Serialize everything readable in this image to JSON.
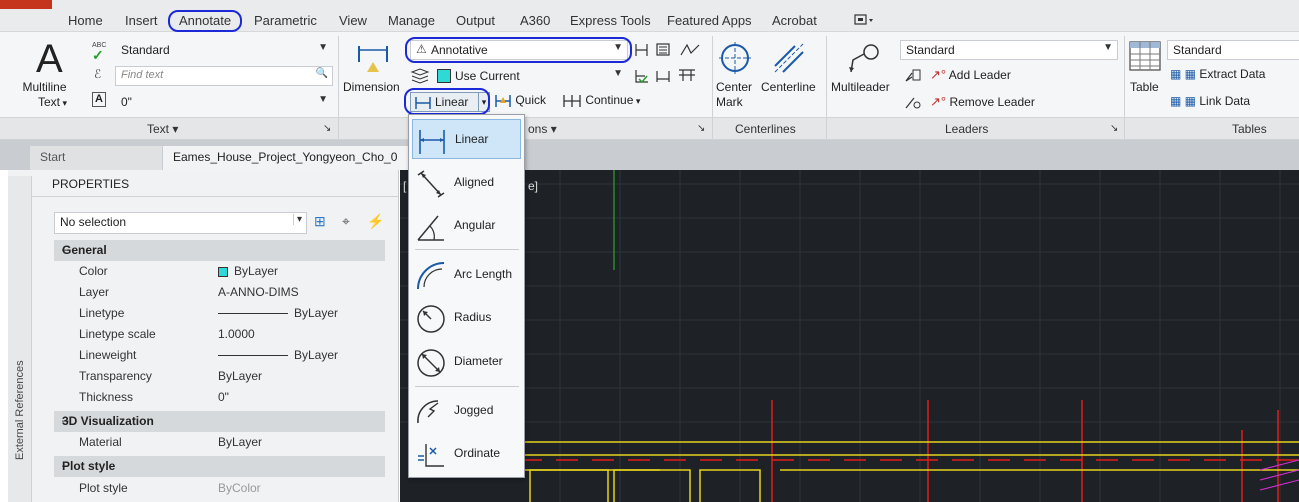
{
  "ribbon_tabs": [
    "Home",
    "Insert",
    "Annotate",
    "Parametric",
    "View",
    "Manage",
    "Output",
    "A360",
    "Express Tools",
    "Featured Apps",
    "Acrobat"
  ],
  "text_panel": {
    "multiline_label1": "Multiline",
    "multiline_label2": "Text",
    "style_value": "Standard",
    "find_placeholder": "Find text",
    "height_value": "0\"",
    "abc_icon": "ABC",
    "title": "Text"
  },
  "dimensions_panel": {
    "dimension_label": "Dimension",
    "dimstyle_value": "Annotative",
    "layer_value": "Use Current",
    "linear_label": "Linear",
    "quick_label": "Quick",
    "continue_label": "Continue",
    "title_suffix": "ons"
  },
  "centerlines_panel": {
    "center_mark_label1": "Center",
    "center_mark_label2": "Mark",
    "centerline_label": "Centerline",
    "title": "Centerlines"
  },
  "leaders_panel": {
    "multileader_label": "Multileader",
    "style_value": "Standard",
    "add_leader": "Add Leader",
    "remove_leader": "Remove Leader",
    "title": "Leaders"
  },
  "tables_panel": {
    "table_label": "Table",
    "style_value": "Standard",
    "extract_data": "Extract Data",
    "link_data": "Link Data",
    "title": "Tables"
  },
  "doc_tabs": {
    "start": "Start",
    "drawing": "Eames_House_Project_Yongyeon_Cho_0"
  },
  "canvas_label_left": "[",
  "canvas_label_right": "e]",
  "properties": {
    "title": "PROPERTIES",
    "selection": "No selection",
    "sidebar_label": "External References",
    "sections": {
      "general": "General",
      "visualization": "3D Visualization",
      "plot_style": "Plot style"
    },
    "general_rows": [
      {
        "label": "Color",
        "value": "ByLayer"
      },
      {
        "label": "Layer",
        "value": "A-ANNO-DIMS"
      },
      {
        "label": "Linetype",
        "value": "ByLayer"
      },
      {
        "label": "Linetype scale",
        "value": "1.0000"
      },
      {
        "label": "Lineweight",
        "value": "ByLayer"
      },
      {
        "label": "Transparency",
        "value": "ByLayer"
      },
      {
        "label": "Thickness",
        "value": "0\""
      }
    ],
    "material": {
      "label": "Material",
      "value": "ByLayer"
    },
    "plotstyle": {
      "label": "Plot style",
      "value": "ByColor"
    }
  },
  "dropdown_items": [
    "Linear",
    "Aligned",
    "Angular",
    "Arc Length",
    "Radius",
    "Diameter",
    "Jogged",
    "Ordinate"
  ],
  "colors": {
    "annotation_oval": "#1b2ad6",
    "canvas_bg": "#1e2227",
    "dim_yellow": "#e6d21c",
    "grid_red": "#e01c1c",
    "selection_blue": "#cfe6f8",
    "bylayer_cyan": "#2fd9d6"
  }
}
